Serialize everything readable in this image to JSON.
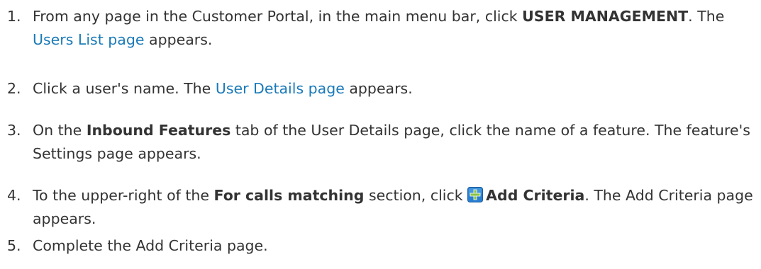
{
  "steps": [
    {
      "number": "1.",
      "pre": "From any page in the Customer Portal, in the main menu bar, click ",
      "bold": "USER MANAGEMENT",
      "mid": ". The ",
      "link": "Users List page",
      "post": " appears."
    },
    {
      "number": "2.",
      "pre": "Click a user's name. The ",
      "link": "User Details page",
      "post": " appears."
    },
    {
      "number": "3.",
      "pre": "On the ",
      "bold": "Inbound Features",
      "post": " tab of the User Details page, click the name of a feature. The feature's Settings page appears."
    },
    {
      "number": "4.",
      "pre": "To the upper-right of the ",
      "bold": "For calls matching",
      "mid": " section, click ",
      "icon": "plus-icon",
      "bold2": "Add Criteria",
      "post": ". The Add Criteria page appears."
    },
    {
      "number": "5.",
      "pre": "Complete the Add Criteria page."
    }
  ],
  "colors": {
    "text": "#333333",
    "link": "#1a7ab8",
    "icon_blue": "#2a7fd0",
    "icon_green": "#8bc34a"
  }
}
